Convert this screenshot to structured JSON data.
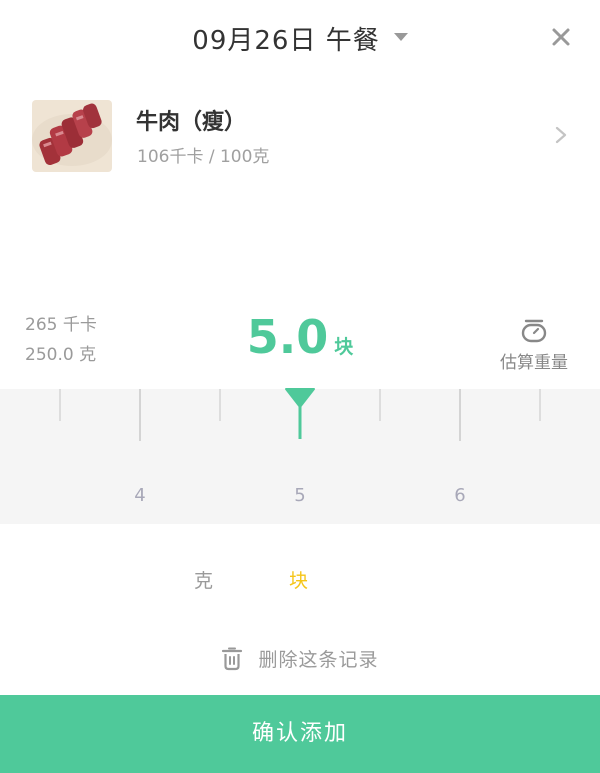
{
  "header": {
    "title": "09月26日 午餐"
  },
  "food": {
    "name": "牛肉（瘦）",
    "desc": "106千卡 / 100克"
  },
  "summary": {
    "kcal": "265 千卡",
    "weight": "250.0 克"
  },
  "amount": {
    "value": "5.0",
    "unit": "块"
  },
  "estimate": {
    "label": "估算重量"
  },
  "ruler": {
    "labels": [
      "4",
      "5",
      "6"
    ]
  },
  "units": {
    "gram": "克",
    "piece": "块"
  },
  "actions": {
    "delete_label": "删除这条记录",
    "confirm_label": "确认添加"
  },
  "colors": {
    "accent": "#4fc99a",
    "selected_unit": "#f5c518"
  }
}
